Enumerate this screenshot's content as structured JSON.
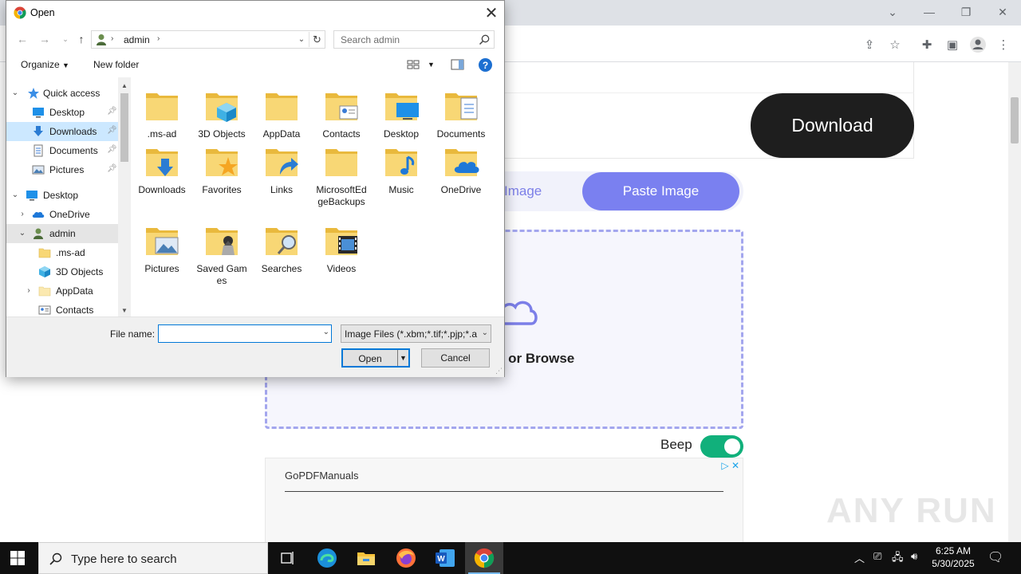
{
  "dialog": {
    "title": "Open",
    "address": {
      "segments": [
        "admin"
      ]
    },
    "search_placeholder": "Search admin",
    "toolbar": {
      "organize": "Organize",
      "new_folder": "New folder",
      "help": "?"
    },
    "nav_items": [
      {
        "label": "Quick access",
        "icon": "star-icon",
        "pinned": false
      },
      {
        "label": "Desktop",
        "icon": "desktop-icon",
        "pinned": true
      },
      {
        "label": "Downloads",
        "icon": "download-icon",
        "pinned": true
      },
      {
        "label": "Documents",
        "icon": "documents-icon",
        "pinned": true
      },
      {
        "label": "Pictures",
        "icon": "pictures-icon",
        "pinned": true
      },
      {
        "label": "Desktop",
        "icon": "desktop-icon",
        "pinned": false
      },
      {
        "label": "OneDrive",
        "icon": "cloud-icon",
        "pinned": false
      },
      {
        "label": "admin",
        "icon": "user-icon",
        "pinned": false
      },
      {
        "label": ".ms-ad",
        "icon": "folder-icon",
        "pinned": false
      },
      {
        "label": "3D Objects",
        "icon": "cube-icon",
        "pinned": false
      },
      {
        "label": "AppData",
        "icon": "folder-icon",
        "pinned": false
      },
      {
        "label": "Contacts",
        "icon": "contacts-icon",
        "pinned": false
      }
    ],
    "files": [
      {
        "label": ".ms-ad",
        "icon": "folder-icon"
      },
      {
        "label": "3D Objects",
        "icon": "folder-3d-icon"
      },
      {
        "label": "AppData",
        "icon": "folder-icon"
      },
      {
        "label": "Contacts",
        "icon": "folder-contacts-icon"
      },
      {
        "label": "Desktop",
        "icon": "folder-desktop-icon"
      },
      {
        "label": "Documents",
        "icon": "folder-documents-icon"
      },
      {
        "label": "Downloads",
        "icon": "folder-downloads-icon"
      },
      {
        "label": "Favorites",
        "icon": "folder-favorites-icon"
      },
      {
        "label": "Links",
        "icon": "folder-links-icon"
      },
      {
        "label": "MicrosoftEdgeBackups",
        "icon": "folder-icon"
      },
      {
        "label": "Music",
        "icon": "folder-music-icon"
      },
      {
        "label": "OneDrive",
        "icon": "folder-onedrive-icon"
      },
      {
        "label": "Pictures",
        "icon": "folder-pictures-icon"
      },
      {
        "label": "Saved Games",
        "icon": "folder-games-icon"
      },
      {
        "label": "Searches",
        "icon": "folder-search-icon"
      },
      {
        "label": "Videos",
        "icon": "folder-videos-icon"
      }
    ],
    "file_name_label": "File name:",
    "file_name_value": "",
    "file_type_filter": "Image Files (*.xbm;*.tif;*.pjp;*.a",
    "open_label": "Open",
    "cancel_label": "Cancel"
  },
  "page": {
    "download_label": "Download",
    "tab_image": "Image",
    "tab_paste": "Paste Image",
    "drop_text": "p or Browse",
    "beep_label": "Beep",
    "beep_on": true,
    "ad_title": "GoPDFManuals",
    "watermark": "ANY RUN"
  },
  "taskbar": {
    "search_placeholder": "Type here to search",
    "time": "6:25 AM",
    "date": "5/30/2025"
  },
  "colors": {
    "accent": "#7a80f0",
    "toggle": "#11b07b",
    "selection": "#0078d7"
  }
}
